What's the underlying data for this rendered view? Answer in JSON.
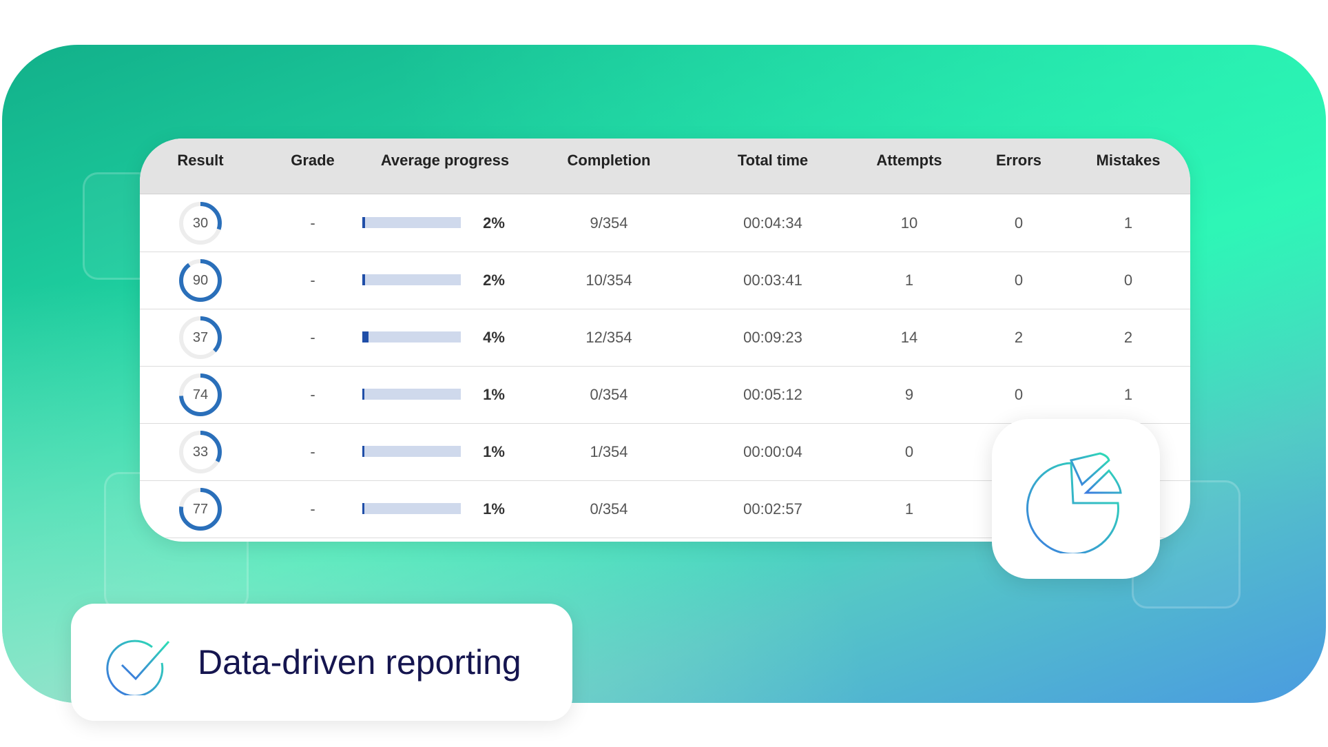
{
  "colors": {
    "ring": "#2a6fba",
    "ring_track": "#ededed",
    "bar_track": "#cfd9ec",
    "bar_fill": "#1f4ea8",
    "caption_text": "#15154f"
  },
  "table": {
    "headers": {
      "result": "Result",
      "grade": "Grade",
      "avg_progress": "Average progress",
      "completion": "Completion",
      "total_time": "Total time",
      "attempts": "Attempts",
      "errors": "Errors",
      "mistakes": "Mistakes"
    },
    "rows": [
      {
        "result": "30",
        "grade": "-",
        "progress": 0.02,
        "progress_label": "2%",
        "completion": "9/354",
        "total_time": "00:04:34",
        "attempts": "10",
        "errors": "0",
        "mistakes": "1"
      },
      {
        "result": "90",
        "grade": "-",
        "progress": 0.02,
        "progress_label": "2%",
        "completion": "10/354",
        "total_time": "00:03:41",
        "attempts": "1",
        "errors": "0",
        "mistakes": "0"
      },
      {
        "result": "37",
        "grade": "-",
        "progress": 0.04,
        "progress_label": "4%",
        "completion": "12/354",
        "total_time": "00:09:23",
        "attempts": "14",
        "errors": "2",
        "mistakes": "2"
      },
      {
        "result": "74",
        "grade": "-",
        "progress": 0.01,
        "progress_label": "1%",
        "completion": "0/354",
        "total_time": "00:05:12",
        "attempts": "9",
        "errors": "0",
        "mistakes": "1"
      },
      {
        "result": "33",
        "grade": "-",
        "progress": 0.01,
        "progress_label": "1%",
        "completion": "1/354",
        "total_time": "00:00:04",
        "attempts": "0",
        "errors": "",
        "mistakes": ""
      },
      {
        "result": "77",
        "grade": "-",
        "progress": 0.01,
        "progress_label": "1%",
        "completion": "0/354",
        "total_time": "00:02:57",
        "attempts": "1",
        "errors": "",
        "mistakes": ""
      }
    ]
  },
  "badge": {
    "icon": "pie-chart-icon"
  },
  "caption": {
    "icon": "checkmark-circle-icon",
    "text": "Data-driven reporting"
  }
}
